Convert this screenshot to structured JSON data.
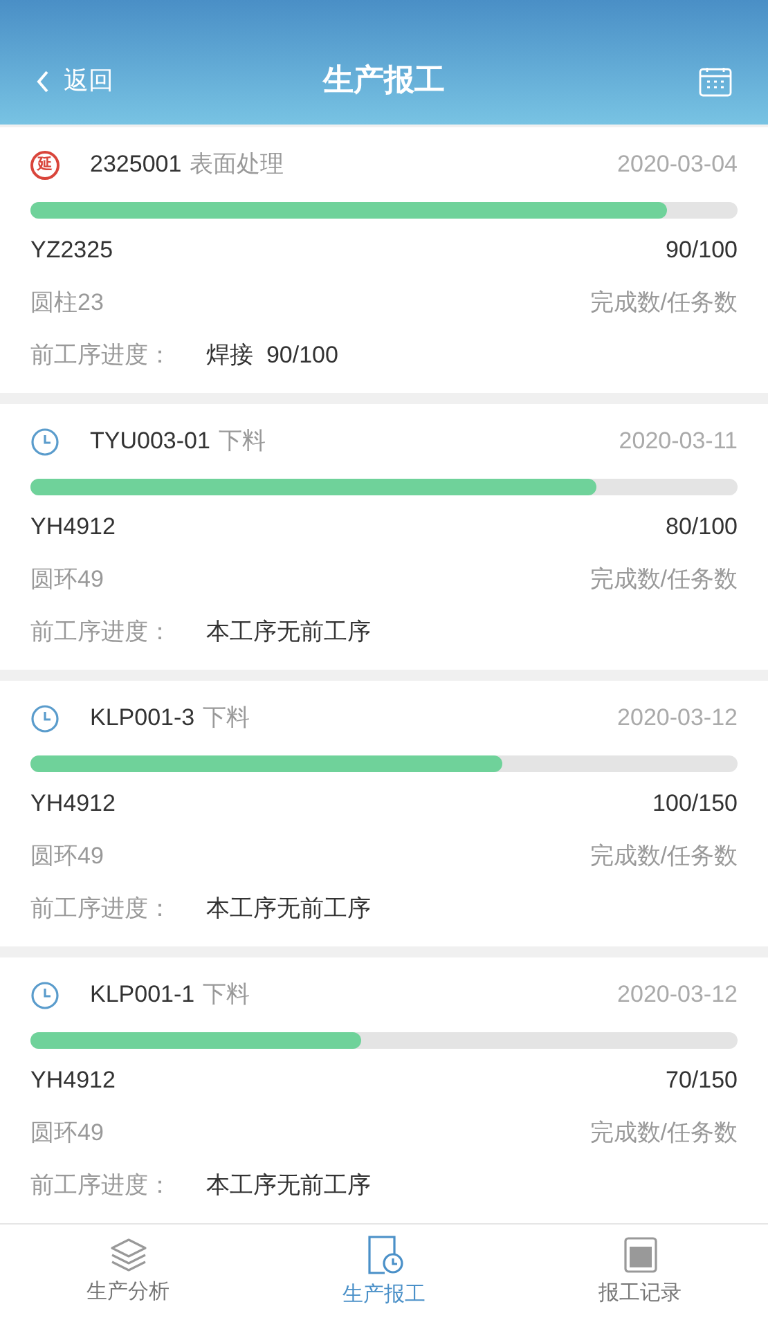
{
  "header": {
    "back": "返回",
    "title": "生产报工"
  },
  "orders": [
    {
      "kind": "delayed",
      "badge": "延",
      "code": "2325001",
      "process": "表面处理",
      "date": "2020-03-04",
      "level": 0.9,
      "part_no": "YZ2325",
      "count": "90/100",
      "part_name": "圆柱23",
      "count_label": "完成数/任务数",
      "prev_label": "前工序进度：",
      "prev_value": "焊接  90/100"
    },
    {
      "kind": "normal",
      "code": "TYU003-01",
      "process": "下料",
      "date": "2020-03-11",
      "level": 0.8,
      "part_no": "YH4912",
      "count": "80/100",
      "part_name": "圆环49",
      "count_label": "完成数/任务数",
      "prev_label": "前工序进度：",
      "prev_value": "本工序无前工序"
    },
    {
      "kind": "normal",
      "code": "KLP001-3",
      "process": "下料",
      "date": "2020-03-12",
      "level": 0.667,
      "part_no": "YH4912",
      "count": "100/150",
      "part_name": "圆环49",
      "count_label": "完成数/任务数",
      "prev_label": "前工序进度：",
      "prev_value": "本工序无前工序"
    },
    {
      "kind": "normal",
      "code": "KLP001-1",
      "process": "下料",
      "date": "2020-03-12",
      "level": 0.467,
      "part_no": "YH4912",
      "count": "70/150",
      "part_name": "圆环49",
      "count_label": "完成数/任务数",
      "prev_label": "前工序进度：",
      "prev_value": "本工序无前工序"
    }
  ],
  "tabs": [
    {
      "kind": "layers",
      "label": "生产分析",
      "selected": false
    },
    {
      "kind": "report",
      "label": "生产报工",
      "selected": true
    },
    {
      "kind": "record",
      "label": "报工记录",
      "selected": false
    }
  ]
}
